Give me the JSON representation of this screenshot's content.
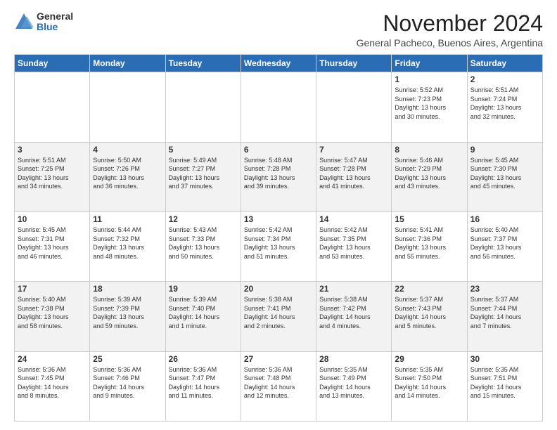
{
  "logo": {
    "general": "General",
    "blue": "Blue"
  },
  "title": "November 2024",
  "location": "General Pacheco, Buenos Aires, Argentina",
  "weekdays": [
    "Sunday",
    "Monday",
    "Tuesday",
    "Wednesday",
    "Thursday",
    "Friday",
    "Saturday"
  ],
  "weeks": [
    [
      {
        "day": "",
        "info": ""
      },
      {
        "day": "",
        "info": ""
      },
      {
        "day": "",
        "info": ""
      },
      {
        "day": "",
        "info": ""
      },
      {
        "day": "",
        "info": ""
      },
      {
        "day": "1",
        "info": "Sunrise: 5:52 AM\nSunset: 7:23 PM\nDaylight: 13 hours\nand 30 minutes."
      },
      {
        "day": "2",
        "info": "Sunrise: 5:51 AM\nSunset: 7:24 PM\nDaylight: 13 hours\nand 32 minutes."
      }
    ],
    [
      {
        "day": "3",
        "info": "Sunrise: 5:51 AM\nSunset: 7:25 PM\nDaylight: 13 hours\nand 34 minutes."
      },
      {
        "day": "4",
        "info": "Sunrise: 5:50 AM\nSunset: 7:26 PM\nDaylight: 13 hours\nand 36 minutes."
      },
      {
        "day": "5",
        "info": "Sunrise: 5:49 AM\nSunset: 7:27 PM\nDaylight: 13 hours\nand 37 minutes."
      },
      {
        "day": "6",
        "info": "Sunrise: 5:48 AM\nSunset: 7:28 PM\nDaylight: 13 hours\nand 39 minutes."
      },
      {
        "day": "7",
        "info": "Sunrise: 5:47 AM\nSunset: 7:28 PM\nDaylight: 13 hours\nand 41 minutes."
      },
      {
        "day": "8",
        "info": "Sunrise: 5:46 AM\nSunset: 7:29 PM\nDaylight: 13 hours\nand 43 minutes."
      },
      {
        "day": "9",
        "info": "Sunrise: 5:45 AM\nSunset: 7:30 PM\nDaylight: 13 hours\nand 45 minutes."
      }
    ],
    [
      {
        "day": "10",
        "info": "Sunrise: 5:45 AM\nSunset: 7:31 PM\nDaylight: 13 hours\nand 46 minutes."
      },
      {
        "day": "11",
        "info": "Sunrise: 5:44 AM\nSunset: 7:32 PM\nDaylight: 13 hours\nand 48 minutes."
      },
      {
        "day": "12",
        "info": "Sunrise: 5:43 AM\nSunset: 7:33 PM\nDaylight: 13 hours\nand 50 minutes."
      },
      {
        "day": "13",
        "info": "Sunrise: 5:42 AM\nSunset: 7:34 PM\nDaylight: 13 hours\nand 51 minutes."
      },
      {
        "day": "14",
        "info": "Sunrise: 5:42 AM\nSunset: 7:35 PM\nDaylight: 13 hours\nand 53 minutes."
      },
      {
        "day": "15",
        "info": "Sunrise: 5:41 AM\nSunset: 7:36 PM\nDaylight: 13 hours\nand 55 minutes."
      },
      {
        "day": "16",
        "info": "Sunrise: 5:40 AM\nSunset: 7:37 PM\nDaylight: 13 hours\nand 56 minutes."
      }
    ],
    [
      {
        "day": "17",
        "info": "Sunrise: 5:40 AM\nSunset: 7:38 PM\nDaylight: 13 hours\nand 58 minutes."
      },
      {
        "day": "18",
        "info": "Sunrise: 5:39 AM\nSunset: 7:39 PM\nDaylight: 13 hours\nand 59 minutes."
      },
      {
        "day": "19",
        "info": "Sunrise: 5:39 AM\nSunset: 7:40 PM\nDaylight: 14 hours\nand 1 minute."
      },
      {
        "day": "20",
        "info": "Sunrise: 5:38 AM\nSunset: 7:41 PM\nDaylight: 14 hours\nand 2 minutes."
      },
      {
        "day": "21",
        "info": "Sunrise: 5:38 AM\nSunset: 7:42 PM\nDaylight: 14 hours\nand 4 minutes."
      },
      {
        "day": "22",
        "info": "Sunrise: 5:37 AM\nSunset: 7:43 PM\nDaylight: 14 hours\nand 5 minutes."
      },
      {
        "day": "23",
        "info": "Sunrise: 5:37 AM\nSunset: 7:44 PM\nDaylight: 14 hours\nand 7 minutes."
      }
    ],
    [
      {
        "day": "24",
        "info": "Sunrise: 5:36 AM\nSunset: 7:45 PM\nDaylight: 14 hours\nand 8 minutes."
      },
      {
        "day": "25",
        "info": "Sunrise: 5:36 AM\nSunset: 7:46 PM\nDaylight: 14 hours\nand 9 minutes."
      },
      {
        "day": "26",
        "info": "Sunrise: 5:36 AM\nSunset: 7:47 PM\nDaylight: 14 hours\nand 11 minutes."
      },
      {
        "day": "27",
        "info": "Sunrise: 5:36 AM\nSunset: 7:48 PM\nDaylight: 14 hours\nand 12 minutes."
      },
      {
        "day": "28",
        "info": "Sunrise: 5:35 AM\nSunset: 7:49 PM\nDaylight: 14 hours\nand 13 minutes."
      },
      {
        "day": "29",
        "info": "Sunrise: 5:35 AM\nSunset: 7:50 PM\nDaylight: 14 hours\nand 14 minutes."
      },
      {
        "day": "30",
        "info": "Sunrise: 5:35 AM\nSunset: 7:51 PM\nDaylight: 14 hours\nand 15 minutes."
      }
    ]
  ]
}
